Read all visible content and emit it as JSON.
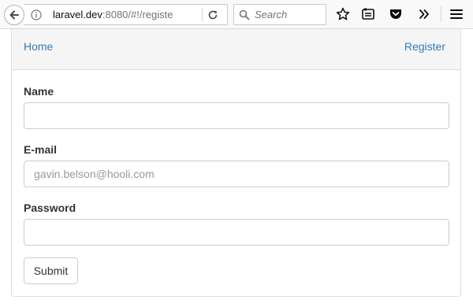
{
  "browser": {
    "url_host": "laravel.dev",
    "url_rest": ":8080/#!/registe",
    "search_placeholder": "Search",
    "icons": [
      "back-arrow-icon",
      "info-icon",
      "reload-icon",
      "search-icon",
      "bookmark-star-icon",
      "reader-view-icon",
      "pocket-icon",
      "overflow-chevron-icon",
      "hamburger-menu-icon"
    ]
  },
  "nav": {
    "home": "Home",
    "register": "Register"
  },
  "form": {
    "name_label": "Name",
    "name_value": "",
    "email_label": "E-mail",
    "email_placeholder": "gavin.belson@hooli.com",
    "password_label": "Password",
    "password_value": "",
    "submit_label": "Submit"
  },
  "colors": {
    "link": "#337ab7",
    "panel_heading_bg": "#f5f5f5",
    "border": "#dddddd"
  }
}
